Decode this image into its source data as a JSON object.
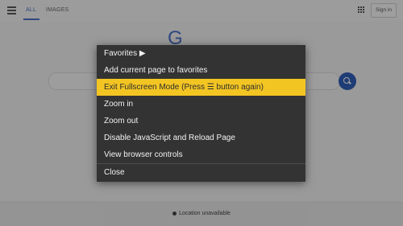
{
  "page": {
    "tabs": [
      "ALL",
      "IMAGES"
    ],
    "signin_label": "Sign in",
    "logo_fragment": "G",
    "footer_text": "Location unavailable"
  },
  "menu": {
    "items": [
      {
        "label": "Favorites ▶"
      },
      {
        "label": "Add current page to favorites"
      },
      {
        "label": "Exit Fullscreen Mode (Press ☰ button again)",
        "selected": true
      },
      {
        "label": "Zoom in"
      },
      {
        "label": "Zoom out"
      },
      {
        "label": "Disable JavaScript and Reload Page"
      },
      {
        "label": "View browser controls"
      },
      {
        "label": "Close"
      }
    ]
  },
  "colors": {
    "menu_bg": "#333333",
    "highlight": "#f3c523",
    "accent": "#4a6fc7"
  },
  "icons": {
    "menu": "hamburger-icon",
    "apps": "apps-grid-icon",
    "search": "search-icon",
    "location": "location-dot-icon"
  }
}
